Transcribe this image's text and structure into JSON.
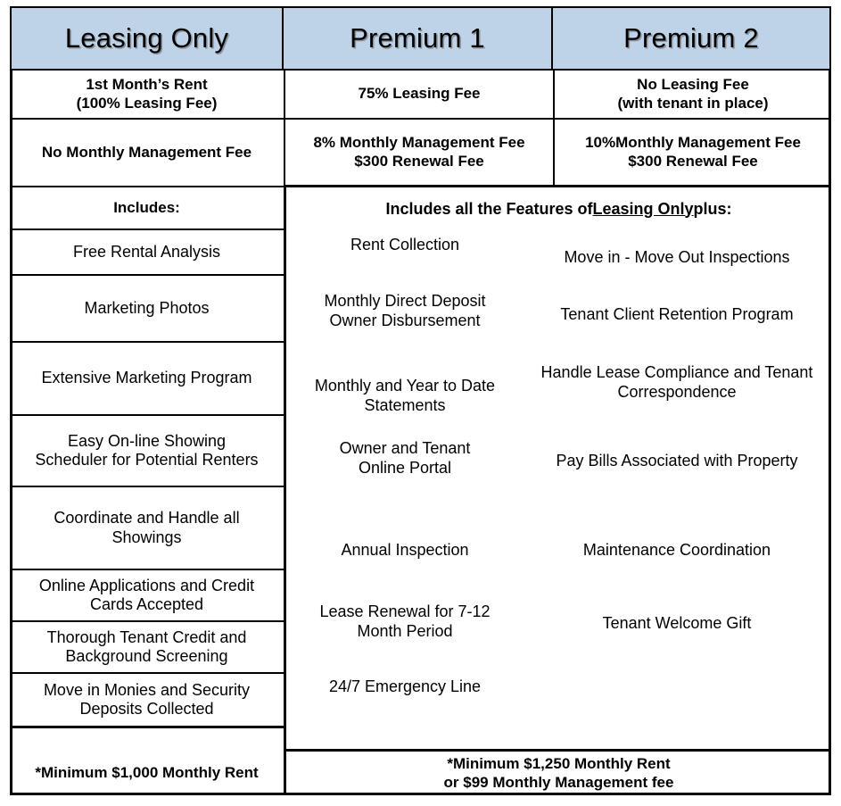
{
  "colors": {
    "header_background": "#bed2e8",
    "border": "#000000",
    "text": "#000000",
    "page_background": "#ffffff"
  },
  "columns": [
    {
      "id": "leasing-only",
      "title": "Leasing Only"
    },
    {
      "id": "premium-1",
      "title": "Premium 1"
    },
    {
      "id": "premium-2",
      "title": "Premium 2"
    }
  ],
  "fee_rows": [
    {
      "label": "leasing-fee",
      "leasing_only": "1st Month’s Rent\n(100% Leasing Fee)",
      "premium_1": "75% Leasing Fee",
      "premium_2": "No Leasing Fee\n(with tenant in place)"
    },
    {
      "label": "management-fee",
      "leasing_only": "No Monthly Management Fee",
      "premium_1": "8% Monthly Management Fee\n$300 Renewal Fee",
      "premium_2": "10%Monthly Management Fee\n$300 Renewal Fee"
    }
  ],
  "includes_header": {
    "leasing_only": "Includes:",
    "premium_prefix": "Includes all the Features of ",
    "premium_underlined": "Leasing Only ",
    "premium_suffix": " plus:"
  },
  "leasing_only_features": [
    "Free Rental Analysis",
    "Marketing Photos",
    "Extensive Marketing Program",
    "Easy On-line Showing\nScheduler for Potential Renters",
    "Coordinate and Handle all\nShowings",
    "Online Applications and Credit\nCards Accepted",
    "Thorough Tenant Credit and\nBackground Screening",
    "Move in Monies and Security\nDeposits Collected"
  ],
  "premium_1_features": [
    "Rent Collection",
    "Monthly Direct Deposit\nOwner Disbursement",
    "Monthly and Year to Date\nStatements",
    "Owner and Tenant\nOnline Portal",
    "Annual Inspection",
    "Lease Renewal for 7-12\nMonth Period",
    "24/7 Emergency Line"
  ],
  "premium_2_features": [
    "Move in - Move Out Inspections",
    "Tenant Client Retention Program",
    "Handle Lease Compliance and Tenant\nCorrespondence",
    "Pay Bills Associated with Property",
    "Maintenance Coordination",
    "Tenant Welcome Gift"
  ],
  "footer": {
    "leasing_only": "*Minimum $1,000 Monthly Rent",
    "premium": "*Minimum $1,250 Monthly Rent\nor $99 Monthly Management fee"
  }
}
